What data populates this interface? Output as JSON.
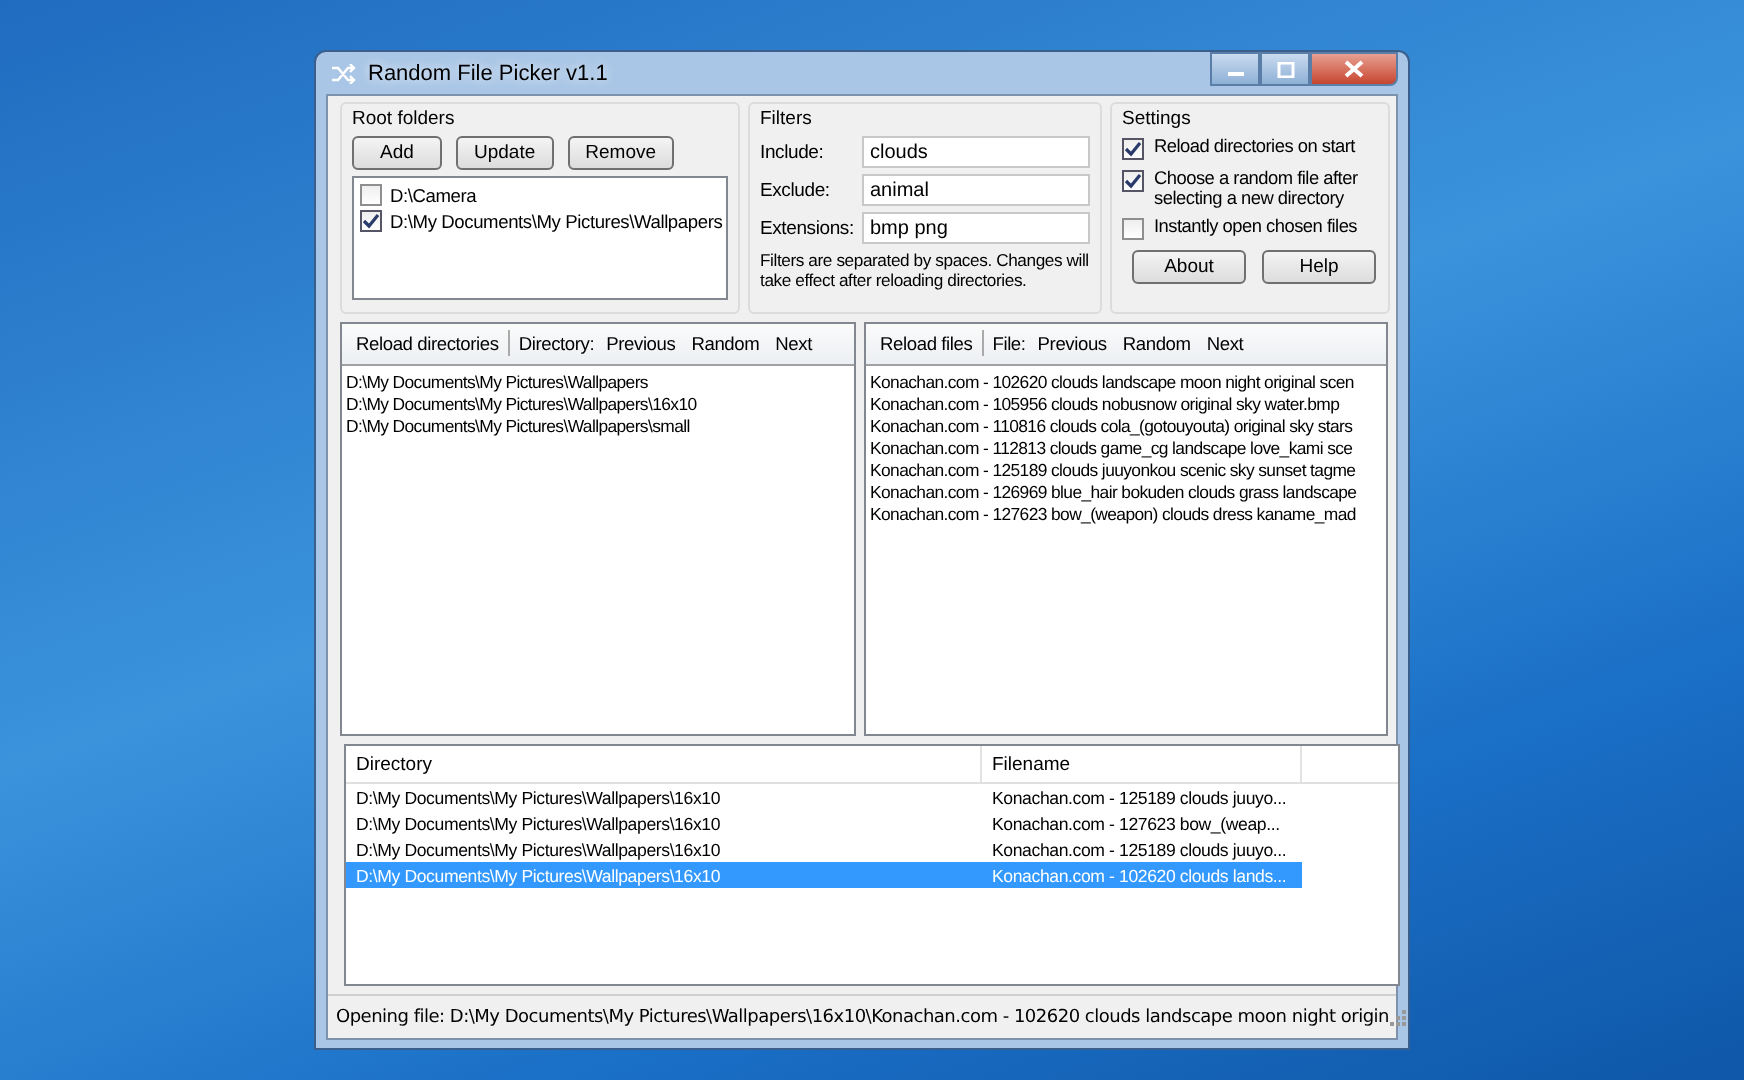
{
  "window": {
    "title": "Random File Picker v1.1"
  },
  "root_folders": {
    "label": "Root folders",
    "buttons": [
      "Add",
      "Update",
      "Remove"
    ],
    "items": [
      {
        "path": "D:\\Camera",
        "checked": false
      },
      {
        "path": "D:\\My Documents\\My Pictures\\Wallpapers",
        "checked": true
      }
    ]
  },
  "filters": {
    "label": "Filters",
    "fields": [
      {
        "label": "Include:",
        "value": "clouds"
      },
      {
        "label": "Exclude:",
        "value": "animal"
      },
      {
        "label": "Extensions:",
        "value": "bmp png"
      }
    ],
    "note": "Filters are separated by spaces. Changes will take effect after reloading directories."
  },
  "settings": {
    "label": "Settings",
    "options": [
      {
        "label": "Reload directories on start",
        "checked": true
      },
      {
        "label": "Choose a random file after selecting a new directory",
        "checked": true
      },
      {
        "label": "Instantly open chosen files",
        "checked": false
      }
    ],
    "buttons": [
      "About",
      "Help"
    ]
  },
  "directories": {
    "reload": "Reload directories",
    "nav_label": "Directory:",
    "nav": [
      "Previous",
      "Random",
      "Next"
    ],
    "items": [
      "D:\\My Documents\\My Pictures\\Wallpapers",
      "D:\\My Documents\\My Pictures\\Wallpapers\\16x10",
      "D:\\My Documents\\My Pictures\\Wallpapers\\small"
    ]
  },
  "files": {
    "reload": "Reload files",
    "nav_label": "File:",
    "nav": [
      "Previous",
      "Random",
      "Next"
    ],
    "items": [
      "Konachan.com - 102620 clouds landscape moon night original scen",
      "Konachan.com - 105956 clouds nobusnow original sky water.bmp",
      "Konachan.com - 110816 clouds cola_(gotouyouta) original sky stars",
      "Konachan.com - 112813 clouds game_cg landscape love_kami sce",
      "Konachan.com - 125189 clouds juuyonkou scenic sky sunset tagme",
      "Konachan.com - 126969 blue_hair bokuden clouds grass landscape",
      "Konachan.com - 127623 bow_(weapon) clouds dress kaname_mad"
    ]
  },
  "history": {
    "columns": [
      "Directory",
      "Filename"
    ],
    "rows": [
      {
        "directory": "D:\\My Documents\\My Pictures\\Wallpapers\\16x10",
        "filename": "Konachan.com - 125189 clouds juuyo...",
        "selected": false
      },
      {
        "directory": "D:\\My Documents\\My Pictures\\Wallpapers\\16x10",
        "filename": "Konachan.com - 127623 bow_(weap...",
        "selected": false
      },
      {
        "directory": "D:\\My Documents\\My Pictures\\Wallpapers\\16x10",
        "filename": "Konachan.com - 125189 clouds juuyo...",
        "selected": false
      },
      {
        "directory": "D:\\My Documents\\My Pictures\\Wallpapers\\16x10",
        "filename": "Konachan.com - 102620 clouds lands...",
        "selected": true
      }
    ]
  },
  "status_bar": "Opening file: D:\\My Documents\\My Pictures\\Wallpapers\\16x10\\Konachan.com - 102620 clouds landscape moon night origin"
}
